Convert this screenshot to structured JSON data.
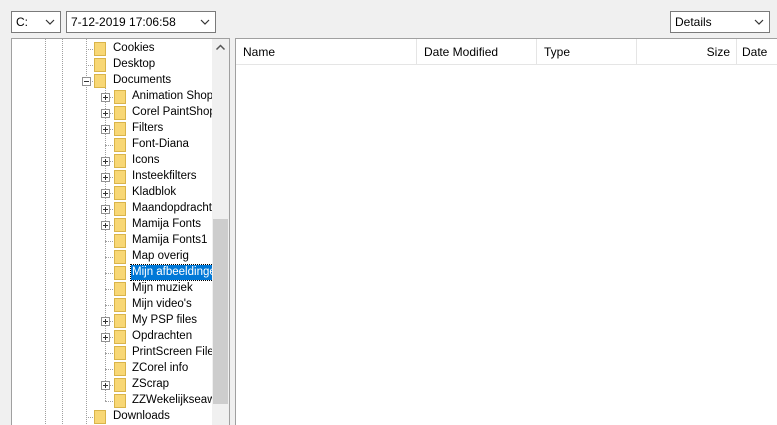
{
  "toolbar": {
    "drive": "C:",
    "datetime": "7-12-2019 17:06:58",
    "view": "Details"
  },
  "tree": {
    "items": [
      {
        "label": "Cookies",
        "level": 1,
        "expandable": false,
        "expanded": false
      },
      {
        "label": "Desktop",
        "level": 1,
        "expandable": false,
        "expanded": false
      },
      {
        "label": "Documents",
        "level": 1,
        "expandable": true,
        "expanded": true
      },
      {
        "label": "Animation Shop v",
        "level": 2,
        "expandable": true,
        "expanded": false
      },
      {
        "label": "Corel PaintShop Pro",
        "level": 2,
        "expandable": true,
        "expanded": false
      },
      {
        "label": "Filters",
        "level": 2,
        "expandable": true,
        "expanded": false
      },
      {
        "label": "Font-Diana",
        "level": 2,
        "expandable": false,
        "expanded": false
      },
      {
        "label": "Icons",
        "level": 2,
        "expandable": true,
        "expanded": false
      },
      {
        "label": "Insteekfilters",
        "level": 2,
        "expandable": true,
        "expanded": false
      },
      {
        "label": "Kladblok",
        "level": 2,
        "expandable": true,
        "expanded": false
      },
      {
        "label": "Maandopdrachten",
        "level": 2,
        "expandable": true,
        "expanded": false
      },
      {
        "label": "Mamija Fonts",
        "level": 2,
        "expandable": true,
        "expanded": false
      },
      {
        "label": "Mamija Fonts1",
        "level": 2,
        "expandable": false,
        "expanded": false
      },
      {
        "label": "Map overig",
        "level": 2,
        "expandable": false,
        "expanded": false
      },
      {
        "label": "Mijn afbeeldingen",
        "level": 2,
        "expandable": false,
        "expanded": false,
        "selected": true
      },
      {
        "label": "Mijn muziek",
        "level": 2,
        "expandable": false,
        "expanded": false
      },
      {
        "label": "Mijn video's",
        "level": 2,
        "expandable": false,
        "expanded": false
      },
      {
        "label": "My PSP files",
        "level": 2,
        "expandable": true,
        "expanded": false
      },
      {
        "label": "Opdrachten",
        "level": 2,
        "expandable": true,
        "expanded": false
      },
      {
        "label": "PrintScreen Files",
        "level": 2,
        "expandable": false,
        "expanded": false
      },
      {
        "label": "ZCorel info",
        "level": 2,
        "expandable": false,
        "expanded": false
      },
      {
        "label": "ZScrap",
        "level": 2,
        "expandable": true,
        "expanded": false
      },
      {
        "label": "ZZWekelijkseaw",
        "level": 2,
        "expandable": false,
        "expanded": false
      },
      {
        "label": "Downloads",
        "level": 1,
        "expandable": false,
        "expanded": false
      }
    ]
  },
  "list": {
    "columns": [
      "Name",
      "Date Modified",
      "Type",
      "Size",
      "Date"
    ]
  },
  "colors": {
    "selection": "#0078d7",
    "folder": "#f8d775"
  }
}
